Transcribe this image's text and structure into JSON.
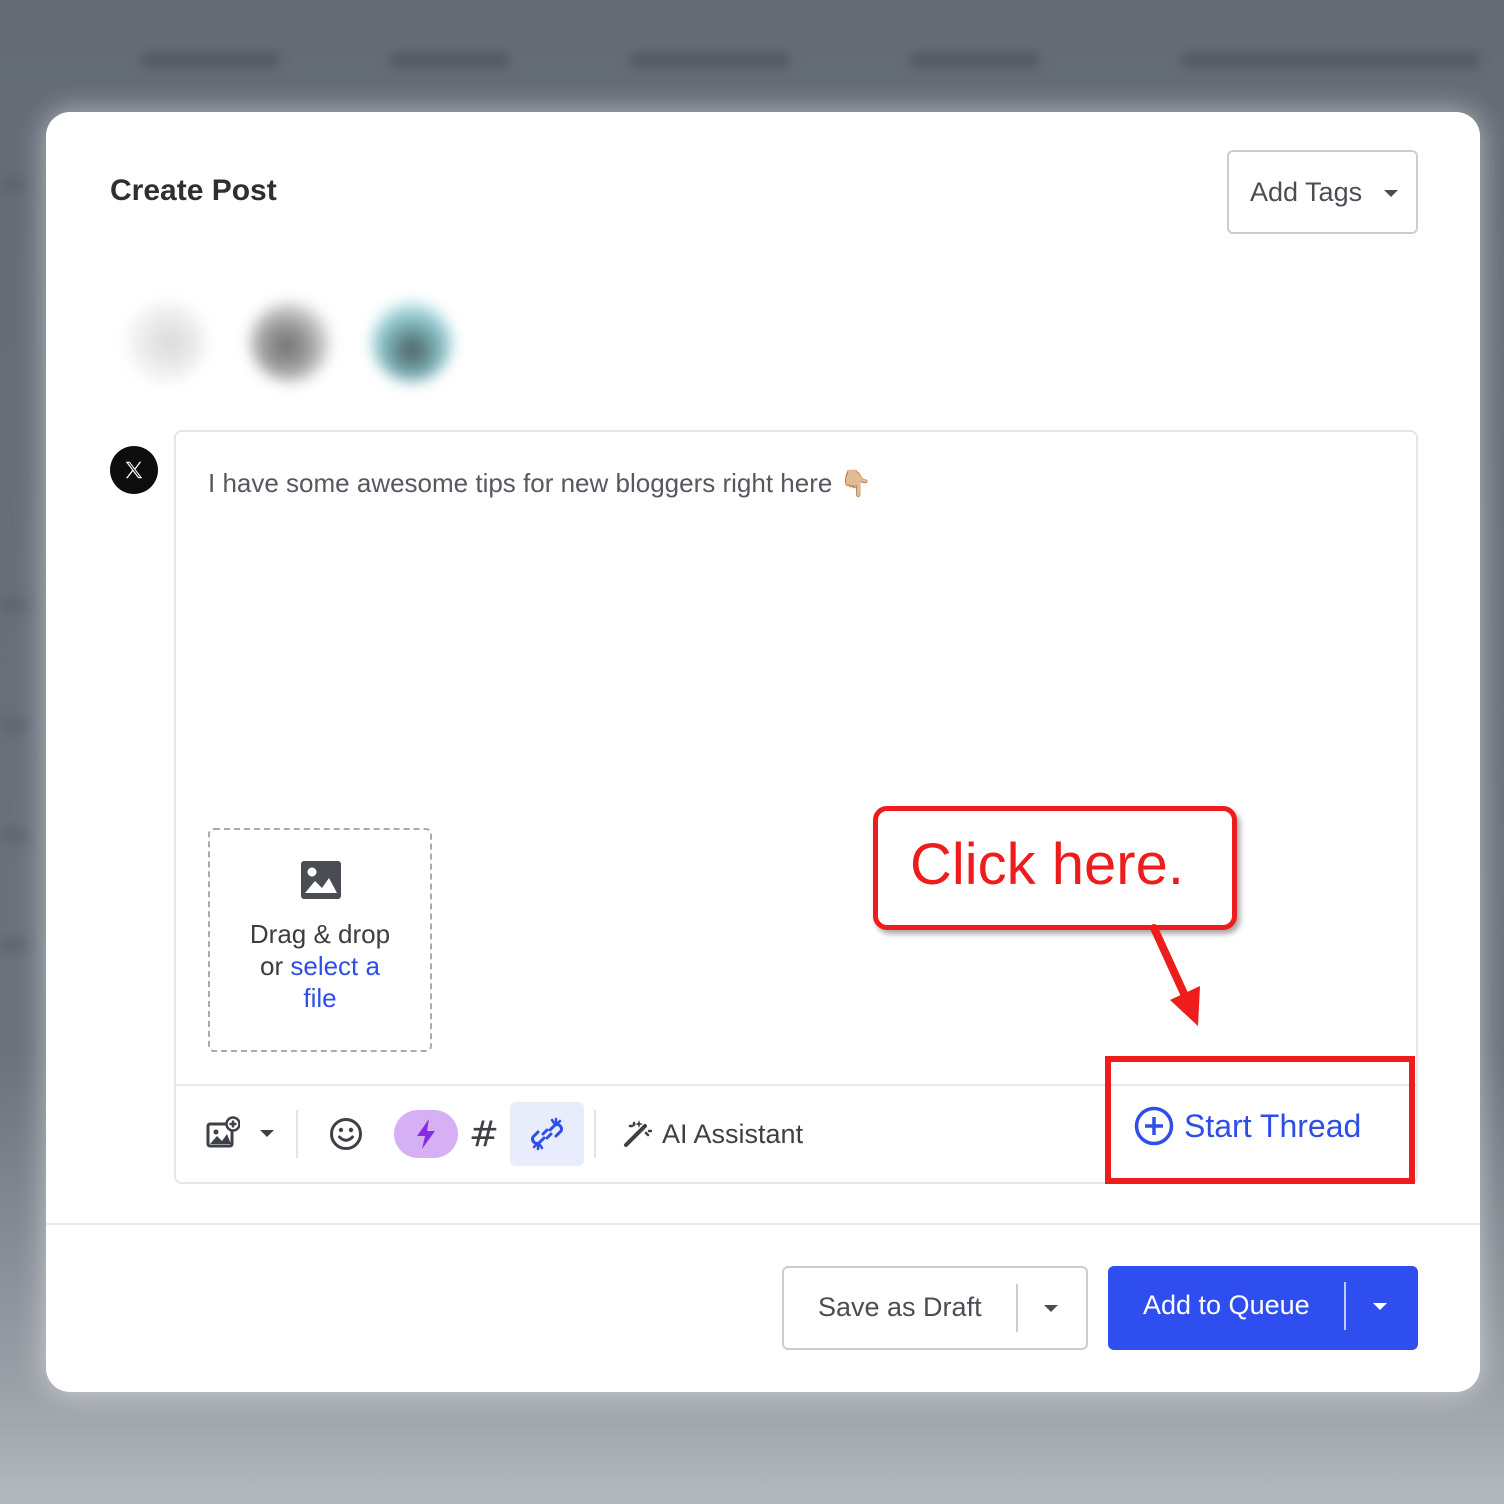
{
  "modal": {
    "title": "Create Post",
    "add_tags_label": "Add Tags"
  },
  "editor": {
    "network_icon": "x-logo-icon",
    "post_text": "I have some awesome tips for new bloggers right here 👇🏼",
    "dropzone": {
      "line1": "Drag & drop",
      "line2_prefix": "or ",
      "link_text": "select a",
      "link_text_2": "file"
    },
    "toolbar": {
      "icons": [
        "add-media-icon",
        "chevron-down-icon",
        "emoji-icon",
        "lightning-icon",
        "hashtag-icon",
        "link-shortener-icon",
        "magic-wand-icon"
      ],
      "ai_assistant_label": "AI Assistant",
      "start_thread_label": "Start Thread"
    }
  },
  "footer": {
    "save_draft_label": "Save as Draft",
    "add_queue_label": "Add to Queue"
  },
  "annotation": {
    "callout_text": "Click here.",
    "color": "#ee1c1c"
  },
  "colors": {
    "primary": "#2f4ef0",
    "link": "#2f4ee8",
    "bolt_bg": "#d6b0f5",
    "link_btn_bg": "#e8ecfb"
  }
}
